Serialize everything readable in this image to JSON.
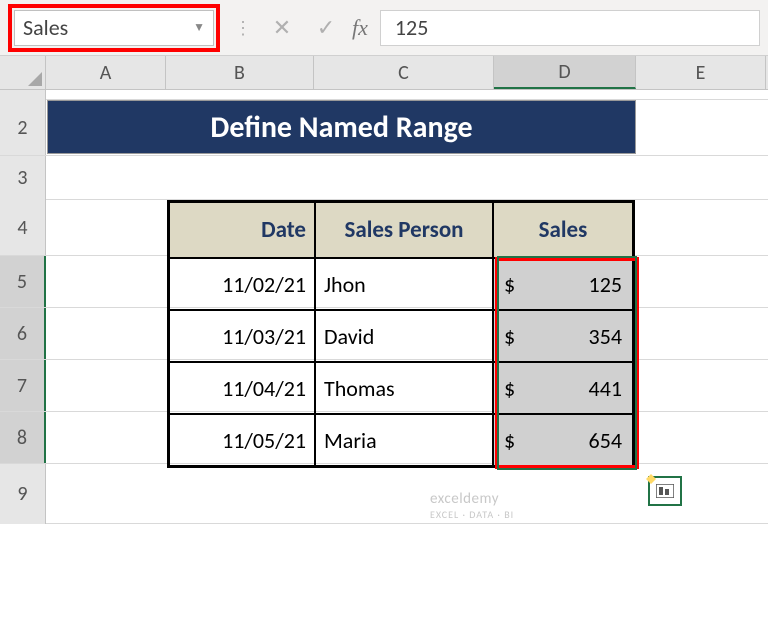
{
  "formula_bar": {
    "name_box_value": "Sales",
    "fx_label": "fx",
    "formula_value": "125"
  },
  "columns": [
    "A",
    "B",
    "C",
    "D",
    "E"
  ],
  "row_numbers": [
    "2",
    "3",
    "4",
    "5",
    "6",
    "7",
    "8",
    "9"
  ],
  "title": "Define Named Range",
  "table": {
    "headers": {
      "date": "Date",
      "person": "Sales Person",
      "sales": "Sales"
    },
    "rows": [
      {
        "date": "11/02/21",
        "person": "Jhon",
        "currency": "$",
        "amount": "125"
      },
      {
        "date": "11/03/21",
        "person": "David",
        "currency": "$",
        "amount": "354"
      },
      {
        "date": "11/04/21",
        "person": "Thomas",
        "currency": "$",
        "amount": "441"
      },
      {
        "date": "11/05/21",
        "person": "Maria",
        "currency": "$",
        "amount": "654"
      }
    ]
  },
  "watermark": {
    "main": "exceldemy",
    "sub": "EXCEL · DATA · BI"
  },
  "chart_data": {
    "type": "table",
    "title": "Define Named Range",
    "columns": [
      "Date",
      "Sales Person",
      "Sales"
    ],
    "rows": [
      [
        "11/02/21",
        "Jhon",
        125
      ],
      [
        "11/03/21",
        "David",
        354
      ],
      [
        "11/04/21",
        "Thomas",
        441
      ],
      [
        "11/05/21",
        "Maria",
        654
      ]
    ],
    "named_range": "Sales",
    "currency": "$"
  }
}
